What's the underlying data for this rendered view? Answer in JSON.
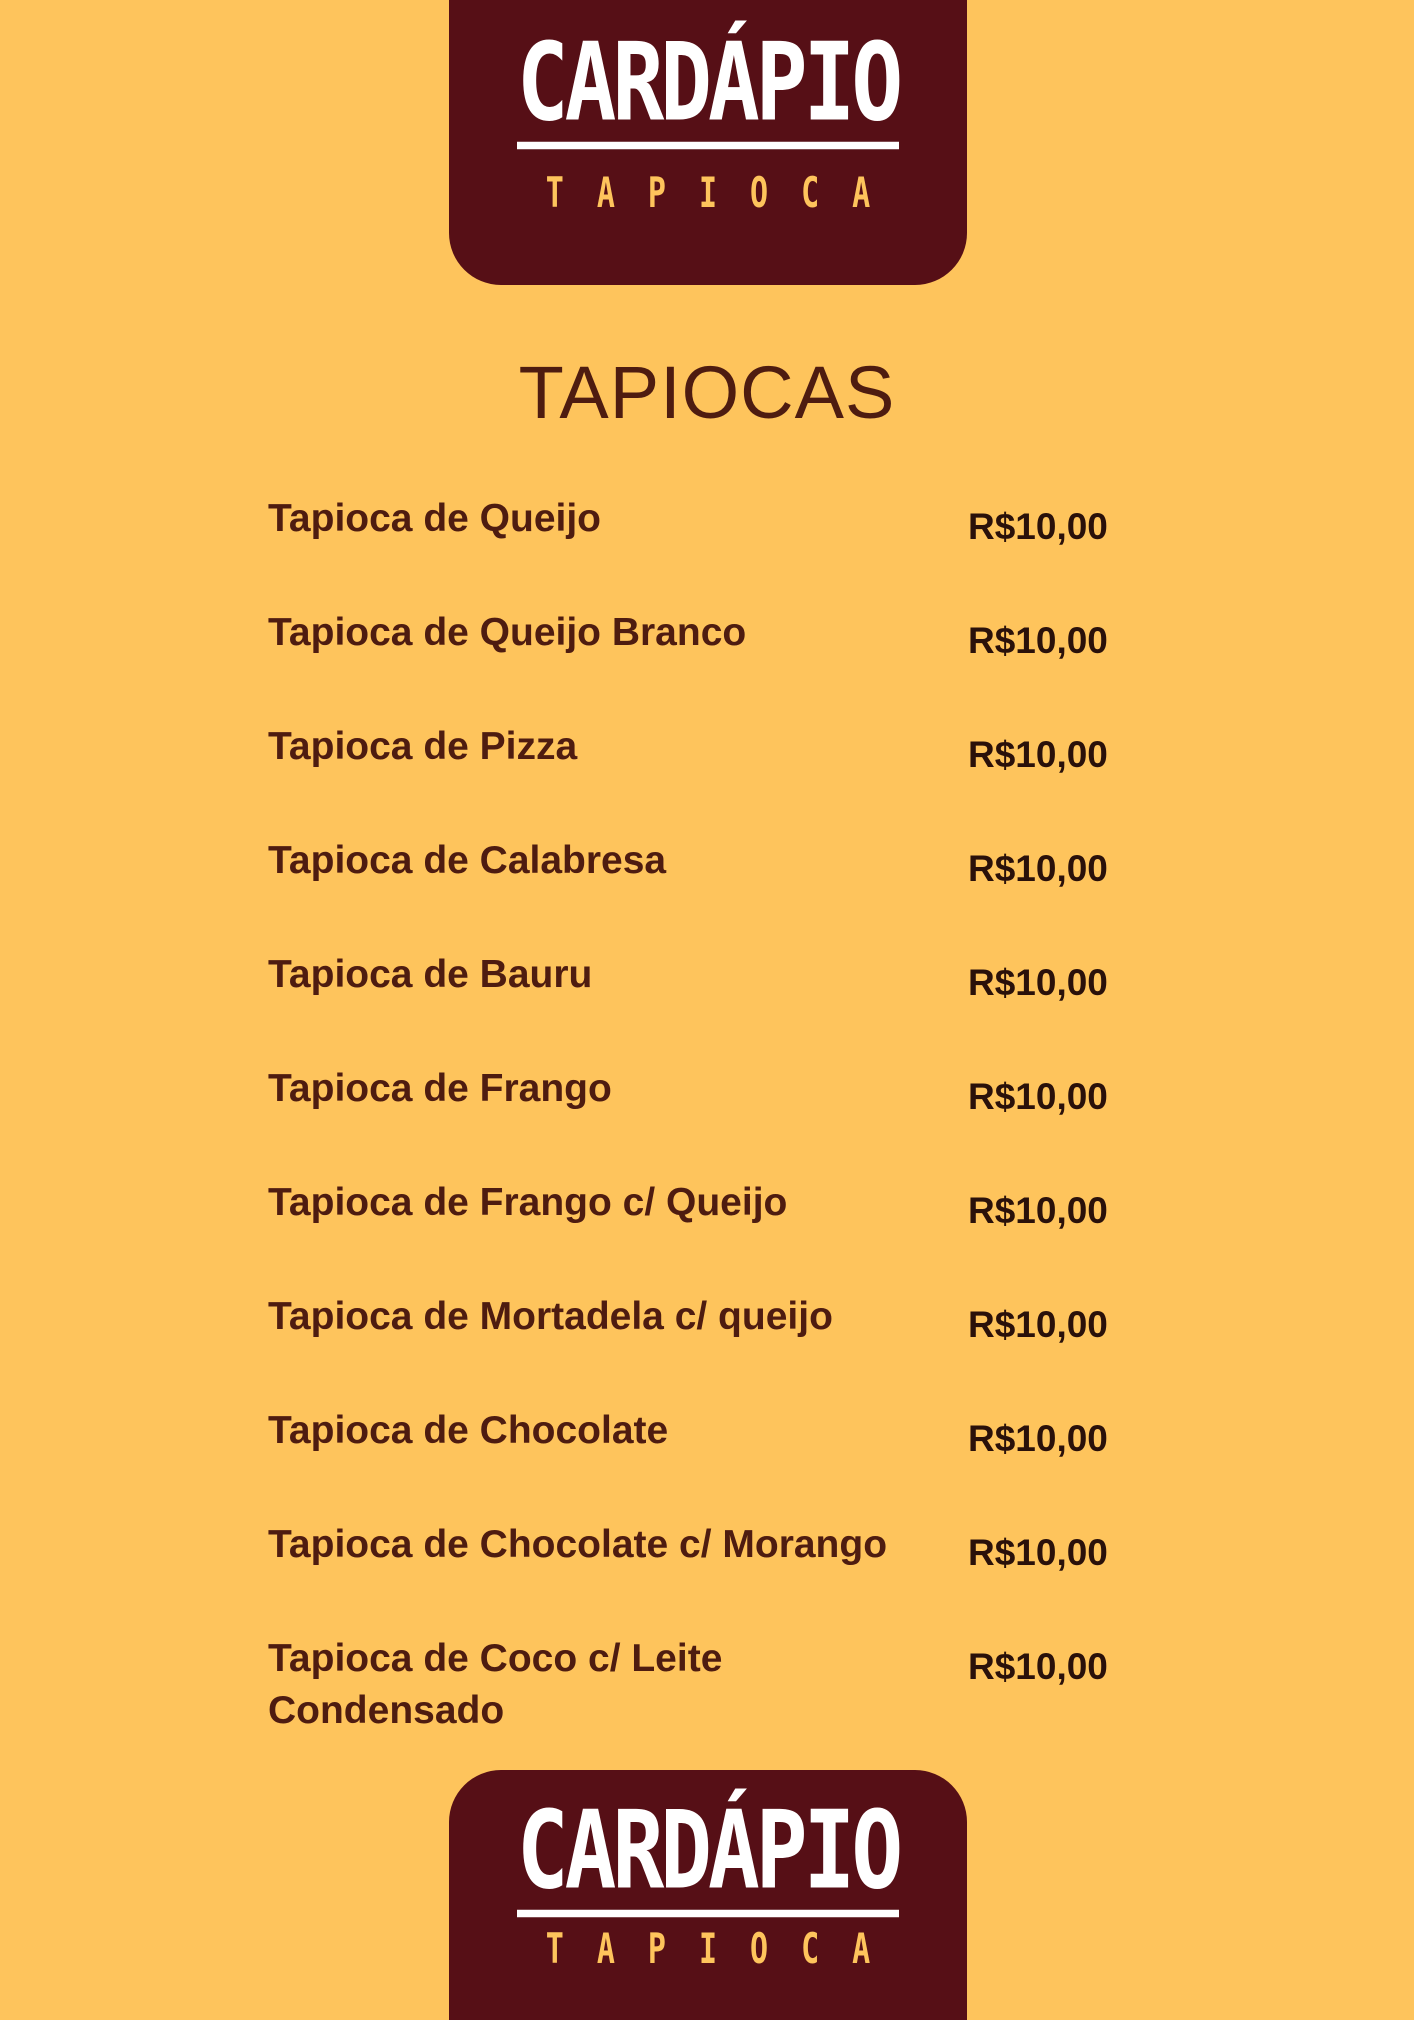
{
  "colors": {
    "background": "#FEC45C",
    "logo_background": "#560F16",
    "logo_text": "#FFFFFF",
    "logo_subtext": "#FEC45C",
    "heading": "#4E1C10",
    "price": "#2A110A"
  },
  "logo": {
    "title": "CARDÁPIO",
    "subtitle": "TAPIOCA"
  },
  "section_title": "TAPIOCAS",
  "menu": [
    {
      "name": "Tapioca de Queijo",
      "price": "R$10,00"
    },
    {
      "name": "Tapioca de Queijo Branco",
      "price": "R$10,00"
    },
    {
      "name": "Tapioca de Pizza",
      "price": "R$10,00"
    },
    {
      "name": "Tapioca de Calabresa",
      "price": "R$10,00"
    },
    {
      "name": "Tapioca de Bauru",
      "price": "R$10,00"
    },
    {
      "name": "Tapioca de Frango",
      "price": "R$10,00"
    },
    {
      "name": "Tapioca de Frango c/ Queijo",
      "price": "R$10,00"
    },
    {
      "name": "Tapioca de Mortadela c/ queijo",
      "price": "R$10,00"
    },
    {
      "name": "Tapioca de Chocolate",
      "price": "R$10,00"
    },
    {
      "name": "Tapioca de Chocolate c/ Morango",
      "price": "R$10,00"
    },
    {
      "name": "Tapioca de Coco c/ Leite Condensado",
      "price": "R$10,00"
    }
  ]
}
